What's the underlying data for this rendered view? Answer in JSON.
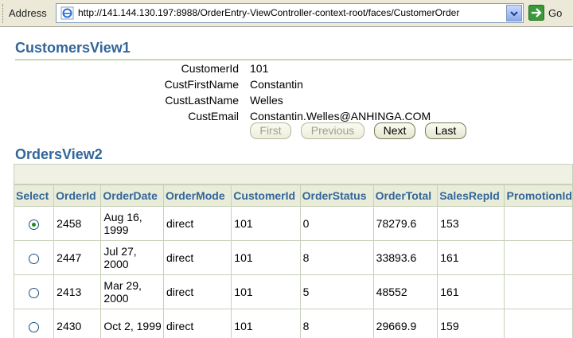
{
  "addressbar": {
    "label": "Address",
    "url": "http://141.144.130.197:8988/OrderEntry-ViewController-context-root/faces/CustomerOrder",
    "go_label": "Go"
  },
  "customers": {
    "title": "CustomersView1",
    "fields": [
      {
        "label": "CustomerId",
        "value": "101"
      },
      {
        "label": "CustFirstName",
        "value": "Constantin"
      },
      {
        "label": "CustLastName",
        "value": "Welles"
      },
      {
        "label": "CustEmail",
        "value": "Constantin.Welles@ANHINGA.COM"
      }
    ],
    "buttons": {
      "first": "First",
      "previous": "Previous",
      "next": "Next",
      "last": "Last"
    }
  },
  "orders": {
    "title": "OrdersView2",
    "columns": [
      "Select",
      "OrderId",
      "OrderDate",
      "OrderMode",
      "CustomerId",
      "OrderStatus",
      "OrderTotal",
      "SalesRepId",
      "PromotionId"
    ],
    "rows": [
      {
        "selected": true,
        "cells": [
          "2458",
          "Aug 16, 1999",
          "direct",
          "101",
          "0",
          "78279.6",
          "153",
          ""
        ]
      },
      {
        "selected": false,
        "cells": [
          "2447",
          "Jul 27, 2000",
          "direct",
          "101",
          "8",
          "33893.6",
          "161",
          ""
        ]
      },
      {
        "selected": false,
        "cells": [
          "2413",
          "Mar 29, 2000",
          "direct",
          "101",
          "5",
          "48552",
          "161",
          ""
        ]
      },
      {
        "selected": false,
        "cells": [
          "2430",
          "Oct 2, 1999",
          "direct",
          "101",
          "8",
          "29669.9",
          "159",
          ""
        ]
      }
    ]
  },
  "colors": {
    "heading": "#336699",
    "header_bg": "#e9ecd9",
    "grid": "#c7d1b8"
  }
}
